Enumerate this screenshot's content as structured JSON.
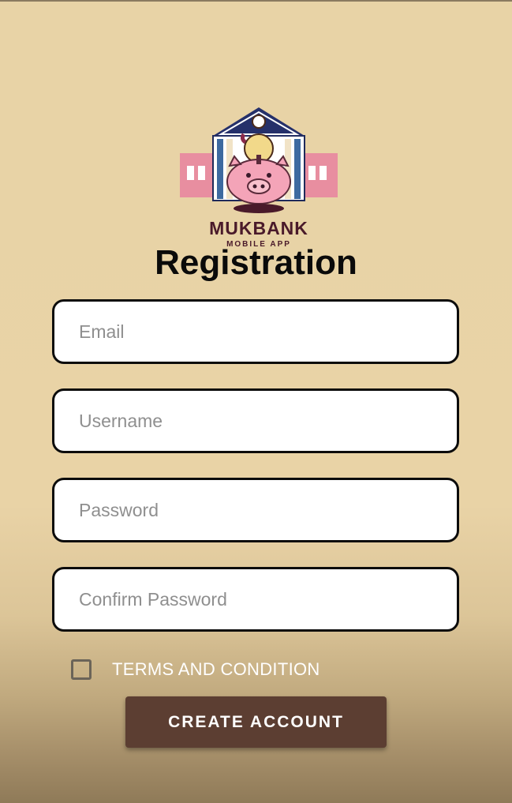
{
  "logo": {
    "brand": "MUKBANK",
    "subtitle": "MOBILE APP"
  },
  "title": "Registration",
  "form": {
    "email": {
      "placeholder": "Email",
      "value": ""
    },
    "username": {
      "placeholder": "Username",
      "value": ""
    },
    "password": {
      "placeholder": "Password",
      "value": ""
    },
    "confirm_password": {
      "placeholder": "Confirm Password",
      "value": ""
    }
  },
  "terms": {
    "label": "TERMS AND CONDITION",
    "checked": false
  },
  "actions": {
    "create_account_label": "CREATE ACCOUNT"
  },
  "colors": {
    "background": "#e8d3a6",
    "button": "#5c3e32",
    "field_border": "#0c0c0c",
    "brand_text": "#4a1a2a"
  },
  "icons": {
    "logo": "piggy-bank-building-logo",
    "checkbox": "checkbox-unchecked"
  }
}
